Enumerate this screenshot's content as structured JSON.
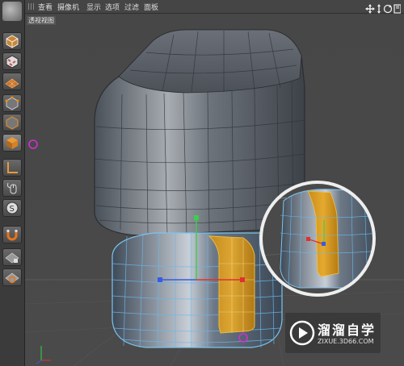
{
  "menu": {
    "items": [
      "查看",
      "摄像机",
      "显示",
      "选项",
      "过滤",
      "面板"
    ]
  },
  "viewport": {
    "label": "透视视图"
  },
  "toolbar": {
    "tools": [
      "model-mode-icon",
      "texture-mode-icon",
      "workplane-icon",
      "points-mode-icon",
      "edges-mode-icon",
      "polygons-mode-icon",
      "axis-mode-icon",
      "tweak-mode-icon",
      "snap-icon",
      "magnet-icon",
      "lock-workplane-icon",
      "grid-snap-icon"
    ]
  },
  "watermark": {
    "title": "溜溜自学",
    "url": "ZIXUE.3D66.COM"
  },
  "colors": {
    "toolbar_bg": "#3b3b3b",
    "viewport_bg": "#464646",
    "selection_yellow": "#e0a020",
    "mesh_blue": "#4ea8e0"
  }
}
